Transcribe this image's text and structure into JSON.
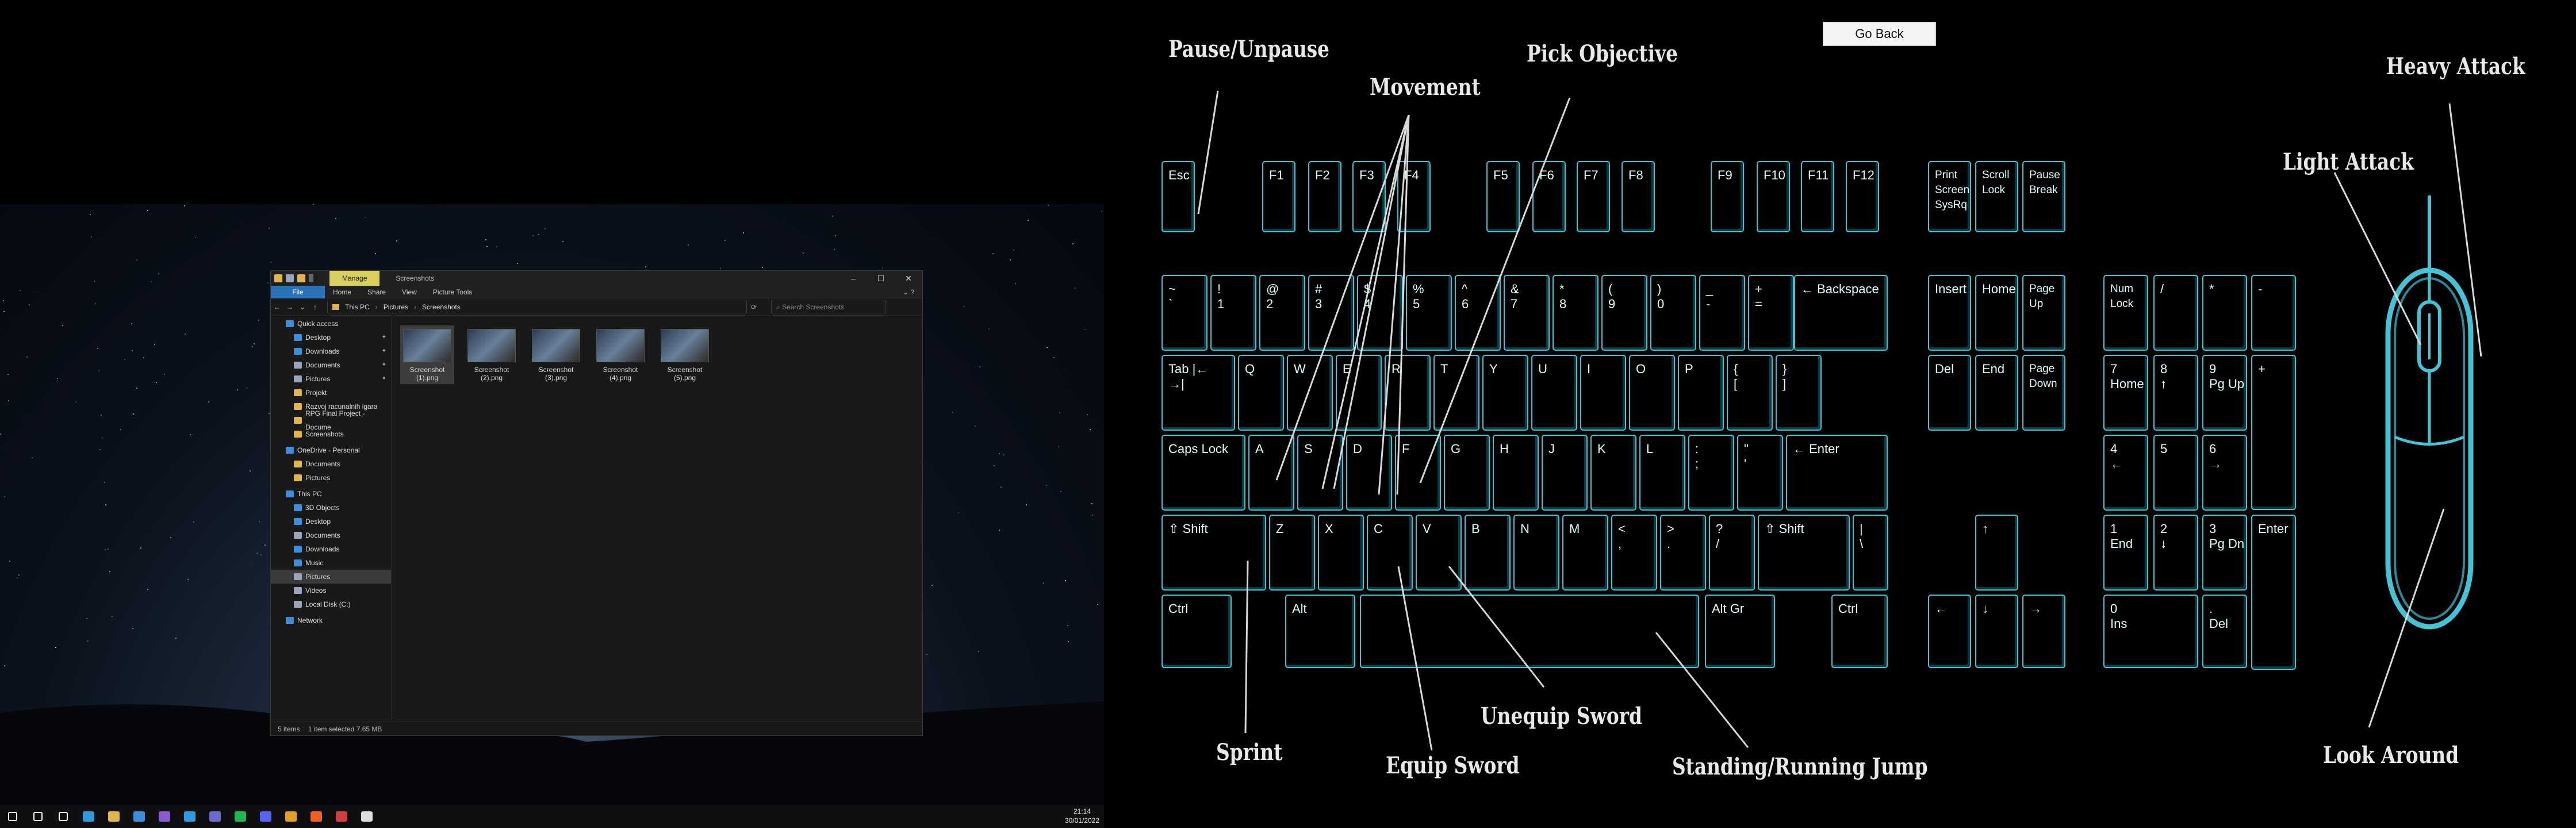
{
  "explorer": {
    "ribbon_manage": "Manage",
    "window_title": "Screenshots",
    "tabs": [
      "File",
      "Home",
      "Share",
      "View"
    ],
    "picture_tools": "Picture Tools",
    "path": [
      "This PC",
      "Pictures",
      "Screenshots"
    ],
    "search_placeholder": "Search Screenshots",
    "nav_items": [
      {
        "label": "Quick access",
        "level": 0,
        "icon": "star-icon",
        "color": "#3b8fe0"
      },
      {
        "label": "Desktop",
        "level": 1,
        "icon": "folder-icon",
        "color": "#3b8fe0",
        "pinned": true
      },
      {
        "label": "Downloads",
        "level": 1,
        "icon": "download-icon",
        "color": "#3b8fe0",
        "pinned": true
      },
      {
        "label": "Documents",
        "level": 1,
        "icon": "folder-icon",
        "color": "#9aa6b8",
        "pinned": true
      },
      {
        "label": "Pictures",
        "level": 1,
        "icon": "folder-icon",
        "color": "#9aa6b8",
        "pinned": true
      },
      {
        "label": "Projekt",
        "level": 1,
        "icon": "folder-icon",
        "color": "#e0b64a"
      },
      {
        "label": "Razvoj racunalnih igara",
        "level": 1,
        "icon": "folder-icon",
        "color": "#e0b64a"
      },
      {
        "label": "RPG Final Project - Docume",
        "level": 1,
        "icon": "folder-icon",
        "color": "#e0b64a"
      },
      {
        "label": "Screenshots",
        "level": 1,
        "icon": "folder-icon",
        "color": "#e0b64a"
      },
      {
        "label": "OneDrive - Personal",
        "level": 0,
        "icon": "cloud-icon",
        "color": "#3b8fe0"
      },
      {
        "label": "Documents",
        "level": 1,
        "icon": "folder-icon",
        "color": "#e0b64a"
      },
      {
        "label": "Pictures",
        "level": 1,
        "icon": "folder-icon",
        "color": "#e0b64a"
      },
      {
        "label": "This PC",
        "level": 0,
        "icon": "pc-icon",
        "color": "#3b8fe0"
      },
      {
        "label": "3D Objects",
        "level": 1,
        "icon": "folder-icon",
        "color": "#3b8fe0"
      },
      {
        "label": "Desktop",
        "level": 1,
        "icon": "folder-icon",
        "color": "#3b8fe0"
      },
      {
        "label": "Documents",
        "level": 1,
        "icon": "folder-icon",
        "color": "#9aa6b8"
      },
      {
        "label": "Downloads",
        "level": 1,
        "icon": "download-icon",
        "color": "#3b8fe0"
      },
      {
        "label": "Music",
        "level": 1,
        "icon": "music-icon",
        "color": "#3b8fe0"
      },
      {
        "label": "Pictures",
        "level": 1,
        "icon": "folder-icon",
        "color": "#9aa6b8",
        "selected": true
      },
      {
        "label": "Videos",
        "level": 1,
        "icon": "folder-icon",
        "color": "#9aa6b8"
      },
      {
        "label": "Local Disk (C:)",
        "level": 1,
        "icon": "disk-icon",
        "color": "#9aa6b8"
      },
      {
        "label": "Network",
        "level": 0,
        "icon": "network-icon",
        "color": "#3b8fe0"
      }
    ],
    "files": [
      {
        "name": "Screenshot (1).png",
        "selected": true
      },
      {
        "name": "Screenshot (2).png",
        "selected": false
      },
      {
        "name": "Screenshot (3).png",
        "selected": false
      },
      {
        "name": "Screenshot (4).png",
        "selected": false
      },
      {
        "name": "Screenshot (5).png",
        "selected": false
      }
    ],
    "status": {
      "count": "5 items",
      "selection": "1 item selected  7.65 MB"
    }
  },
  "taskbar": {
    "time": "21:14",
    "date": "30/01/2022",
    "icons": [
      {
        "name": "windows-start-icon",
        "color": "#ffffff"
      },
      {
        "name": "search-icon",
        "color": "#ffffff"
      },
      {
        "name": "task-view-icon",
        "color": "#ffffff"
      },
      {
        "name": "edge-icon",
        "color": "#2e9be0"
      },
      {
        "name": "file-explorer-icon",
        "color": "#e0b64a"
      },
      {
        "name": "store-icon",
        "color": "#3b8fe0"
      },
      {
        "name": "visual-studio-icon",
        "color": "#8a5cd0"
      },
      {
        "name": "vscode-icon",
        "color": "#2e9be0"
      },
      {
        "name": "teams-icon",
        "color": "#6a6acf"
      },
      {
        "name": "spotify-icon",
        "color": "#1db954"
      },
      {
        "name": "discord-icon",
        "color": "#5865f2"
      },
      {
        "name": "chrome-icon",
        "color": "#e0a020"
      },
      {
        "name": "brave-icon",
        "color": "#f06020"
      },
      {
        "name": "chrome-alt-icon",
        "color": "#d04040"
      },
      {
        "name": "unity-icon",
        "color": "#dddddd"
      }
    ]
  },
  "controls": {
    "go_back": "Go Back",
    "labels": {
      "pause": "Pause/Unpause",
      "movement": "Movement",
      "pick_objective": "Pick Objective",
      "heavy_attack": "Heavy Attack",
      "light_attack": "Light Attack",
      "sprint": "Sprint",
      "equip_sword": "Equip Sword",
      "unequip_sword": "Unequip Sword",
      "jump": "Standing/Running Jump",
      "look_around": "Look Around"
    },
    "keys": {
      "esc": "Esc",
      "f1": "F1",
      "f2": "F2",
      "f3": "F3",
      "f4": "F4",
      "f5": "F5",
      "f6": "F6",
      "f7": "F7",
      "f8": "F8",
      "f9": "F9",
      "f10": "F10",
      "f11": "F11",
      "f12": "F12",
      "prtsc": "Print\nScreen\nSysRq",
      "scroll": "Scroll\nLock",
      "pause": "Pause\nBreak",
      "tilde": "~\n`",
      "n1": "!\n1",
      "n2": "@\n2",
      "n3": "#\n3",
      "n4": "$\n4",
      "n5": "%\n5",
      "n6": "^\n6",
      "n7": "&\n7",
      "n8": "*\n8",
      "n9": "(\n9",
      "n0": ")\n0",
      "minus": "_\n-",
      "equals": "+\n=",
      "backspace": "← Backspace",
      "insert": "Insert",
      "home": "Home",
      "pgup": "Page\nUp",
      "numlock": "Num\nLock",
      "npslash": "/",
      "npstar": "*",
      "npminus": "-",
      "tab": "Tab  |←\n      →|",
      "q": "Q",
      "w": "W",
      "e": "E",
      "r": "R",
      "t": "T",
      "y": "Y",
      "u": "U",
      "i": "I",
      "o": "O",
      "p": "P",
      "lbrack": "{\n[",
      "rbrack": "}\n]",
      "del": "Del",
      "end": "End",
      "pgdn": "Page\nDown",
      "np7": "7\nHome",
      "np8": "8\n↑",
      "np9": "9\nPg Up",
      "npplus": "+",
      "caps": "Caps Lock",
      "a": "A",
      "s": "S",
      "d": "D",
      "f": "F",
      "g": "G",
      "h": "H",
      "j": "J",
      "k": "K",
      "l": "L",
      "semi": ":\n;",
      "quote": "\"\n'",
      "enter": "← Enter",
      "np4": "4\n←",
      "np5": "5",
      "np6": "6\n→",
      "lshift": "⇧ Shift",
      "z": "Z",
      "x": "X",
      "c": "C",
      "v": "V",
      "b": "B",
      "n": "N",
      "m": "M",
      "comma": "<\n,",
      "period": ">\n.",
      "slash": "?\n/",
      "rshift": "⇧ Shift",
      "backslash": "|\n\\",
      "up": "↑",
      "np1": "1\nEnd",
      "np2": "2\n↓",
      "np3": "3\nPg Dn",
      "npenter": "Enter",
      "lctrl": "Ctrl",
      "alt": "Alt",
      "space": "",
      "altgr": "Alt Gr",
      "rctrl": "Ctrl",
      "left": "←",
      "down": "↓",
      "right": "→",
      "np0": "0\nIns",
      "npdot": ".\nDel"
    }
  }
}
